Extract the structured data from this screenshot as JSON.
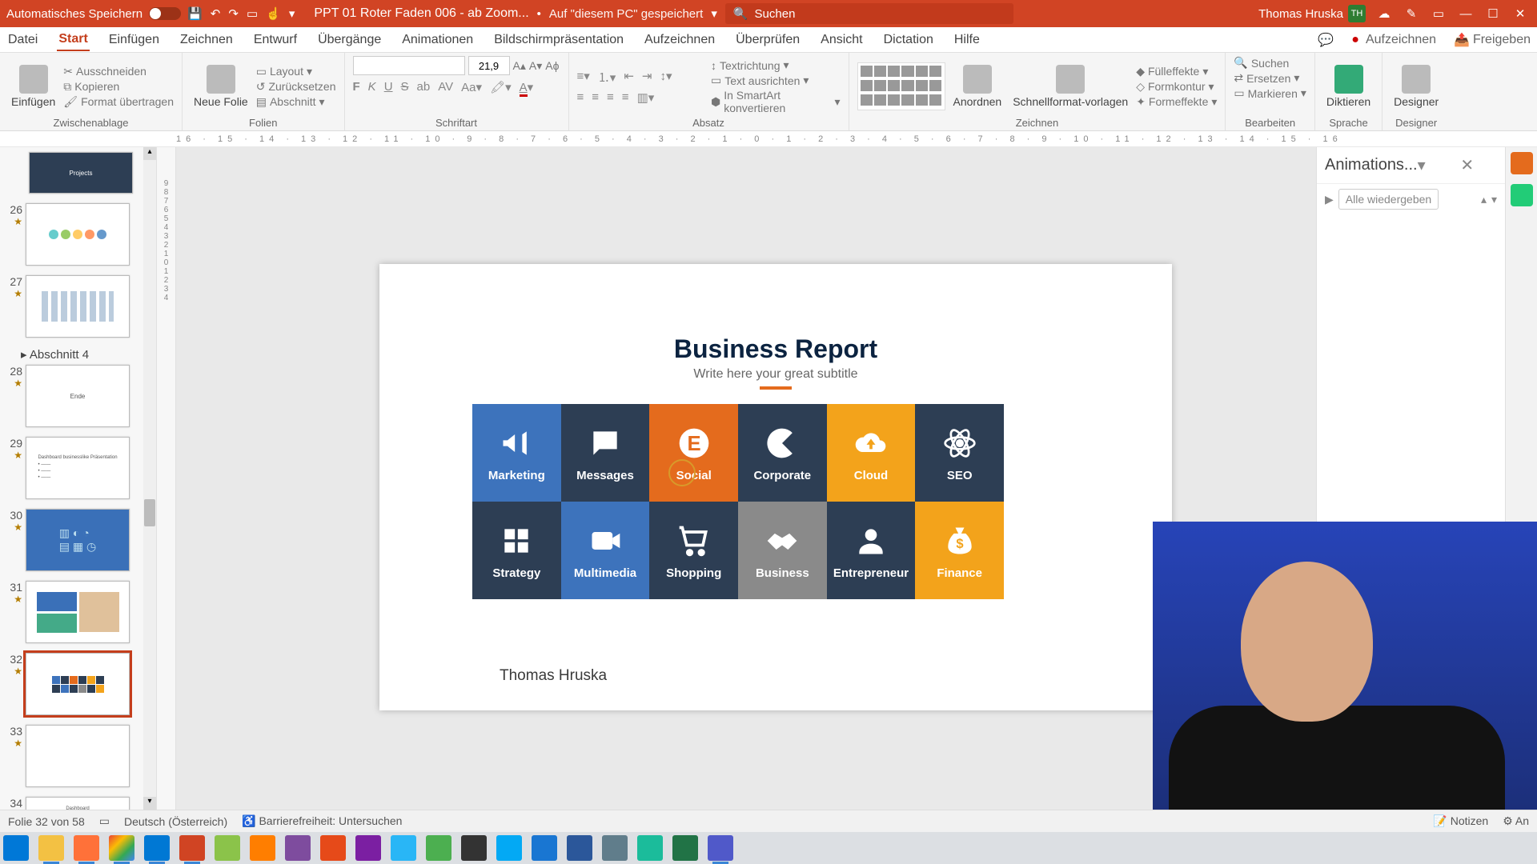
{
  "titlebar": {
    "autosave_label": "Automatisches Speichern",
    "doc_name": "PPT 01 Roter Faden 006 - ab Zoom...",
    "saved_prefix": "Auf \"diesem PC\" gespeichert",
    "search_placeholder": "Suchen",
    "user_name": "Thomas Hruska",
    "user_initials": "TH"
  },
  "tabs": [
    "Datei",
    "Start",
    "Einfügen",
    "Zeichnen",
    "Entwurf",
    "Übergänge",
    "Animationen",
    "Bildschirmpräsentation",
    "Aufzeichnen",
    "Überprüfen",
    "Ansicht",
    "Dictation",
    "Hilfe"
  ],
  "tab_actions": {
    "record": "Aufzeichnen",
    "share": "Freigeben"
  },
  "ribbon": {
    "clipboard": {
      "paste": "Einfügen",
      "cut": "Ausschneiden",
      "copy": "Kopieren",
      "format_painter": "Format übertragen",
      "group": "Zwischenablage"
    },
    "slides": {
      "new_slide": "Neue Folie",
      "layout": "Layout",
      "reset": "Zurücksetzen",
      "section": "Abschnitt",
      "group": "Folien"
    },
    "font": {
      "size": "21,9",
      "group": "Schriftart",
      "bold": "F",
      "italic": "K",
      "underline": "U",
      "strike": "S"
    },
    "paragraph": {
      "group": "Absatz",
      "text_dir": "Textrichtung",
      "align": "Text ausrichten",
      "smartart": "In SmartArt konvertieren"
    },
    "drawing": {
      "arrange": "Anordnen",
      "quick": "Schnellformat-vorlagen",
      "fill": "Fülleffekte",
      "outline": "Formkontur",
      "effects": "Formeffekte",
      "group": "Zeichnen"
    },
    "editing": {
      "find": "Suchen",
      "replace": "Ersetzen",
      "select": "Markieren",
      "group": "Bearbeiten"
    },
    "voice": {
      "dictate": "Diktieren",
      "group": "Sprache"
    },
    "designer": {
      "btn": "Designer",
      "group": "Designer"
    }
  },
  "thumbs": {
    "section_top": "Projects",
    "section_label": "Abschnitt 4",
    "items": [
      {
        "n": "26",
        "star": true
      },
      {
        "n": "27",
        "star": true
      },
      {
        "n": "28",
        "star": true,
        "label": "Ende"
      },
      {
        "n": "29",
        "star": true
      },
      {
        "n": "30",
        "star": true
      },
      {
        "n": "31",
        "star": true
      },
      {
        "n": "32",
        "star": true,
        "selected": true
      },
      {
        "n": "33",
        "star": true
      },
      {
        "n": "34",
        "star": true
      }
    ]
  },
  "slide": {
    "title": "Business Report",
    "subtitle": "Write here your great subtitle",
    "author": "Thomas Hruska",
    "tiles": [
      {
        "label": "Marketing",
        "color": "c-blue",
        "icon": "megaphone"
      },
      {
        "label": "Messages",
        "color": "c-navy",
        "icon": "chat"
      },
      {
        "label": "Social",
        "color": "c-orange",
        "icon": "circlee"
      },
      {
        "label": "Corporate",
        "color": "c-navy",
        "icon": "pac"
      },
      {
        "label": "Cloud",
        "color": "c-amber",
        "icon": "cloudup"
      },
      {
        "label": "SEO",
        "color": "c-navy",
        "icon": "atom"
      },
      {
        "label": "Strategy",
        "color": "c-navy",
        "icon": "grid"
      },
      {
        "label": "Multimedia",
        "color": "c-blue",
        "icon": "video"
      },
      {
        "label": "Shopping",
        "color": "c-navy",
        "icon": "cart"
      },
      {
        "label": "Business",
        "color": "c-gray",
        "icon": "handshake"
      },
      {
        "label": "Entrepreneur",
        "color": "c-navy",
        "icon": "person"
      },
      {
        "label": "Finance",
        "color": "c-amber",
        "icon": "moneybag"
      }
    ]
  },
  "anim_pane": {
    "title": "Animations...",
    "play_all": "Alle wiedergeben"
  },
  "statusbar": {
    "slide_info": "Folie 32 von 58",
    "lang": "Deutsch (Österreich)",
    "a11y": "Barrierefreiheit: Untersuchen",
    "notes": "Notizen",
    "anim": "An"
  },
  "ruler": "16 · 15 · 14 · 13 · 12 · 11 · 10 · 9 · 8 · 7 · 6 · 5 · 4 · 3 · 2 · 1 · 0 · 1 · 2 · 3 · 4 · 5 · 6 · 7 · 8 · 9 · 10 · 11 · 12 · 13 · 14 · 15 · 16",
  "colors": {
    "brand": "#d14424",
    "navy": "#2d3e54",
    "blue": "#3d73bc",
    "orange": "#e46b1d",
    "amber": "#f3a31b",
    "gray": "#8a8a8a"
  }
}
